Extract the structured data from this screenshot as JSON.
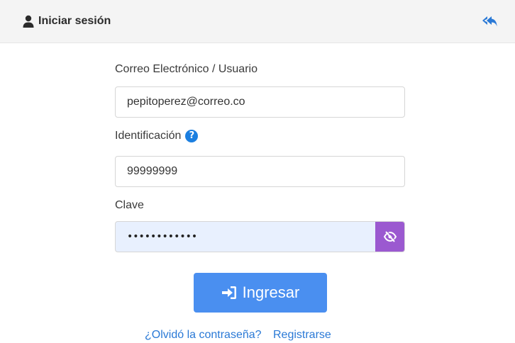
{
  "header": {
    "title": "Iniciar sesión",
    "user_icon": "user-icon",
    "back_icon": "reply-all-icon"
  },
  "form": {
    "user": {
      "label": "Correo Electrónico / Usuario",
      "value": "pepitoperez@correo.co"
    },
    "identification": {
      "label": "Identificación",
      "help_icon": "question-circle-icon",
      "help_glyph": "?",
      "value": "99999999"
    },
    "password": {
      "label": "Clave",
      "value": "••••••••••••",
      "toggle_icon": "eye-slash-icon"
    }
  },
  "actions": {
    "login_label": "Ingresar",
    "login_icon": "sign-in-icon",
    "forgot_password": "¿Olvidó la contraseña?",
    "register": "Registrarse"
  },
  "colors": {
    "header_bg": "#f4f4f4",
    "primary_button": "#4a8ff0",
    "toggle_button": "#9b59d0",
    "link": "#2a79d6",
    "help_icon": "#1b7fe0",
    "autofill_bg": "#e8f0fe"
  }
}
